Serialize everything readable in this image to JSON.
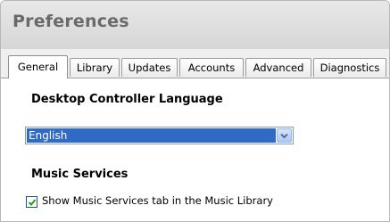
{
  "window": {
    "title": "Preferences"
  },
  "tabs": [
    {
      "label": "General",
      "active": true
    },
    {
      "label": "Library",
      "active": false
    },
    {
      "label": "Updates",
      "active": false
    },
    {
      "label": "Accounts",
      "active": false
    },
    {
      "label": "Advanced",
      "active": false
    },
    {
      "label": "Diagnostics",
      "active": false
    }
  ],
  "general": {
    "language_heading": "Desktop Controller Language",
    "language_select": {
      "selected": "English"
    },
    "music_services_heading": "Music Services",
    "show_music_services": {
      "label": "Show Music Services tab in the Music Library",
      "checked": true
    }
  },
  "icons": {
    "dropdown": "chevron-down-icon",
    "check": "checkmark-icon"
  },
  "colors": {
    "selection": "#316ac5",
    "title_text": "#6a6a6a",
    "checkmark": "#21a121"
  }
}
